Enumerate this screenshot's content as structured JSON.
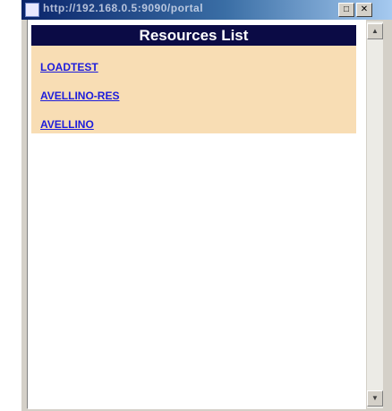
{
  "window": {
    "title": "http://192.168.0.5:9090/portal",
    "icons": {
      "app": "browser-icon",
      "maximize": "maximize-icon",
      "close": "close-icon",
      "scroll_up": "arrow-up-icon",
      "scroll_down": "arrow-down-icon"
    },
    "buttons": {
      "maximize_glyph": "□",
      "close_glyph": "✕",
      "scroll_up_glyph": "▲",
      "scroll_down_glyph": "▼"
    }
  },
  "resources": {
    "header": "Resources List",
    "links": [
      "LOADTEST",
      "AVELLINO-RES",
      "AVELLINO"
    ]
  },
  "colors": {
    "header_bg": "#0b0b45",
    "list_bg": "#f8ddb4",
    "link": "#1c1cdc"
  }
}
